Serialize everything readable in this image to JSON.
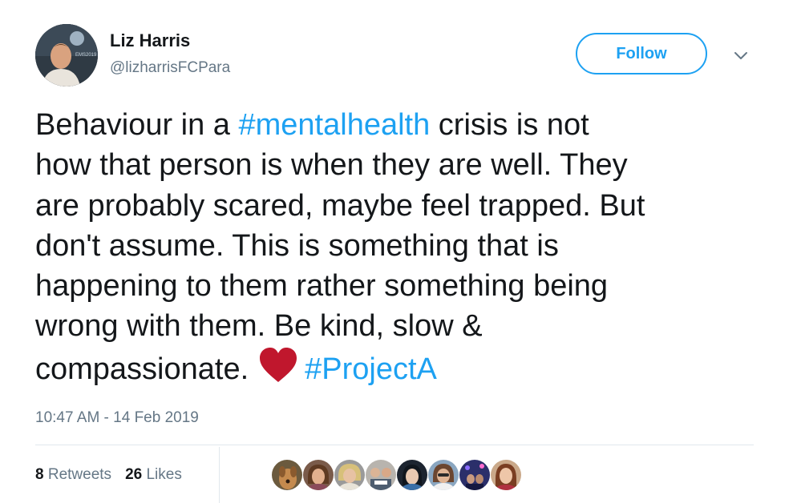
{
  "user": {
    "display_name": "Liz Harris",
    "handle": "@lizharrisFCPara",
    "avatar_badge_text": "EMS2019"
  },
  "actions": {
    "follow_label": "Follow",
    "menu_icon": "chevron-down-icon"
  },
  "tweet": {
    "lines": [
      [
        "Behaviour in a ",
        "#mentalhealth",
        " crisis is not"
      ],
      [
        "how that person is when they are well. They"
      ],
      [
        "are probably scared, maybe feel trapped. But"
      ],
      [
        "don't assume. This is something that is"
      ],
      [
        "happening to them rather something being"
      ],
      [
        "wrong with them. Be kind, slow &"
      ],
      [
        "compassionate.",
        "#ProjectA"
      ]
    ],
    "hashtag_1": "#mentalhealth",
    "hashtag_2": "#ProjectA",
    "emoji": "heart-icon",
    "timestamp": "10:47 AM - 14 Feb 2019"
  },
  "stats": {
    "retweets_count": "8",
    "retweets_label": "Retweets",
    "likes_count": "26",
    "likes_label": "Likes"
  },
  "likers_count_shown": 8,
  "colors": {
    "accent": "#1da1f2",
    "text": "#14171a",
    "secondary": "#657786",
    "heart": "#c0172d",
    "divider": "#e1e8ed"
  }
}
